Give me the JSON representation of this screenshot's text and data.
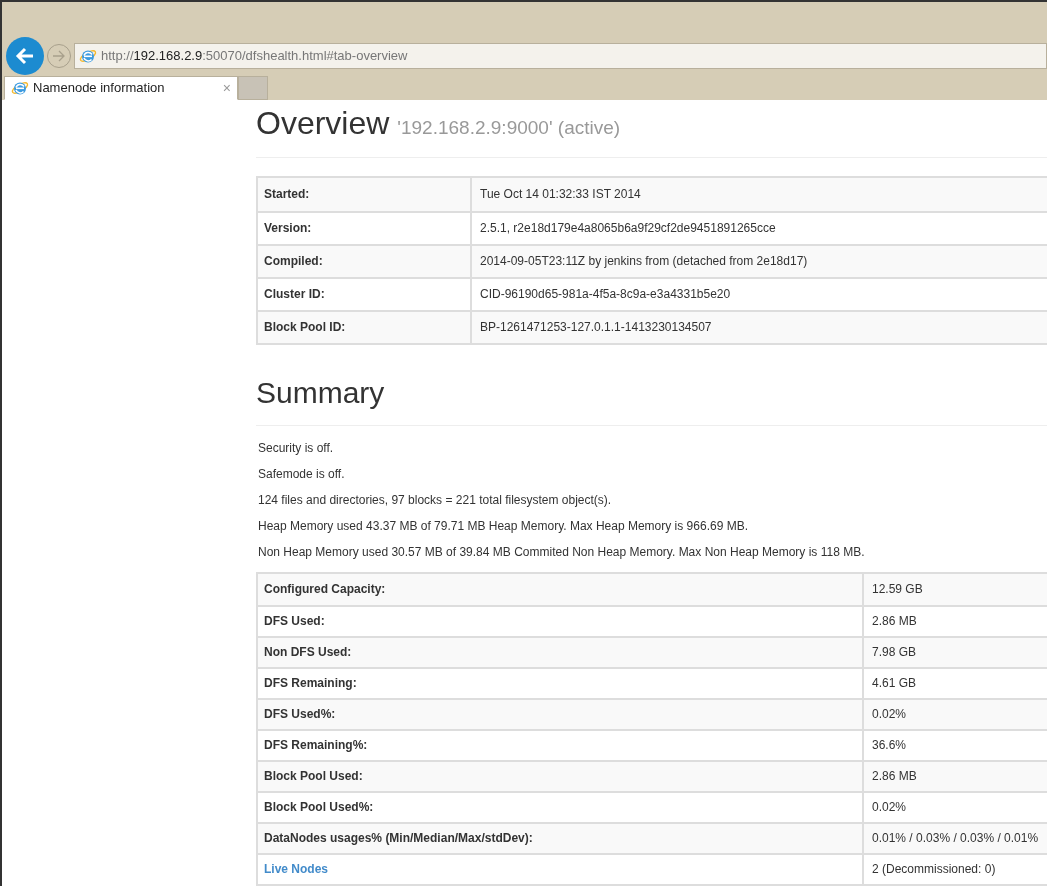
{
  "address_bar": {
    "scheme": "http://",
    "host": "192.168.2.9",
    "rest": ":50070/dfshealth.html#tab-overview"
  },
  "tabs": [
    {
      "label": "Namenode information",
      "selected": true,
      "close": "×"
    }
  ],
  "overview": {
    "title": "Overview",
    "subtitle": "'192.168.2.9:9000' (active)",
    "rows": [
      {
        "label": "Started:",
        "value": "Tue Oct 14 01:32:33 IST 2014"
      },
      {
        "label": "Version:",
        "value": "2.5.1, r2e18d179e4a8065b6a9f29cf2de9451891265cce"
      },
      {
        "label": "Compiled:",
        "value": "2014-09-05T23:11Z by jenkins from (detached from 2e18d17)"
      },
      {
        "label": "Cluster ID:",
        "value": "CID-96190d65-981a-4f5a-8c9a-e3a4331b5e20"
      },
      {
        "label": "Block Pool ID:",
        "value": "BP-1261471253-127.0.1.1-1413230134507"
      }
    ]
  },
  "summary": {
    "title": "Summary",
    "lines": [
      "Security is off.",
      "Safemode is off.",
      "124 files and directories, 97 blocks = 221 total filesystem object(s).",
      "Heap Memory used 43.37 MB of 79.71 MB Heap Memory. Max Heap Memory is 966.69 MB.",
      "Non Heap Memory used 30.57 MB of 39.84 MB Commited Non Heap Memory. Max Non Heap Memory is 118 MB."
    ],
    "rows": [
      {
        "kind": "text",
        "label": "Configured Capacity:",
        "value": "12.59 GB"
      },
      {
        "kind": "text",
        "label": "DFS Used:",
        "value": "2.86 MB"
      },
      {
        "kind": "text",
        "label": "Non DFS Used:",
        "value": "7.98 GB"
      },
      {
        "kind": "text",
        "label": "DFS Remaining:",
        "value": "4.61 GB"
      },
      {
        "kind": "text",
        "label": "DFS Used%:",
        "value": "0.02%"
      },
      {
        "kind": "text",
        "label": "DFS Remaining%:",
        "value": "36.6%"
      },
      {
        "kind": "text",
        "label": "Block Pool Used:",
        "value": "2.86 MB"
      },
      {
        "kind": "text",
        "label": "Block Pool Used%:",
        "value": "0.02%"
      },
      {
        "kind": "text",
        "label": "DataNodes usages% (Min/Median/Max/stdDev):",
        "value": "0.01% / 0.03% / 0.03% / 0.01%"
      },
      {
        "kind": "link",
        "label": "Live Nodes",
        "value": "2 (Decommissioned: 0)"
      }
    ]
  }
}
